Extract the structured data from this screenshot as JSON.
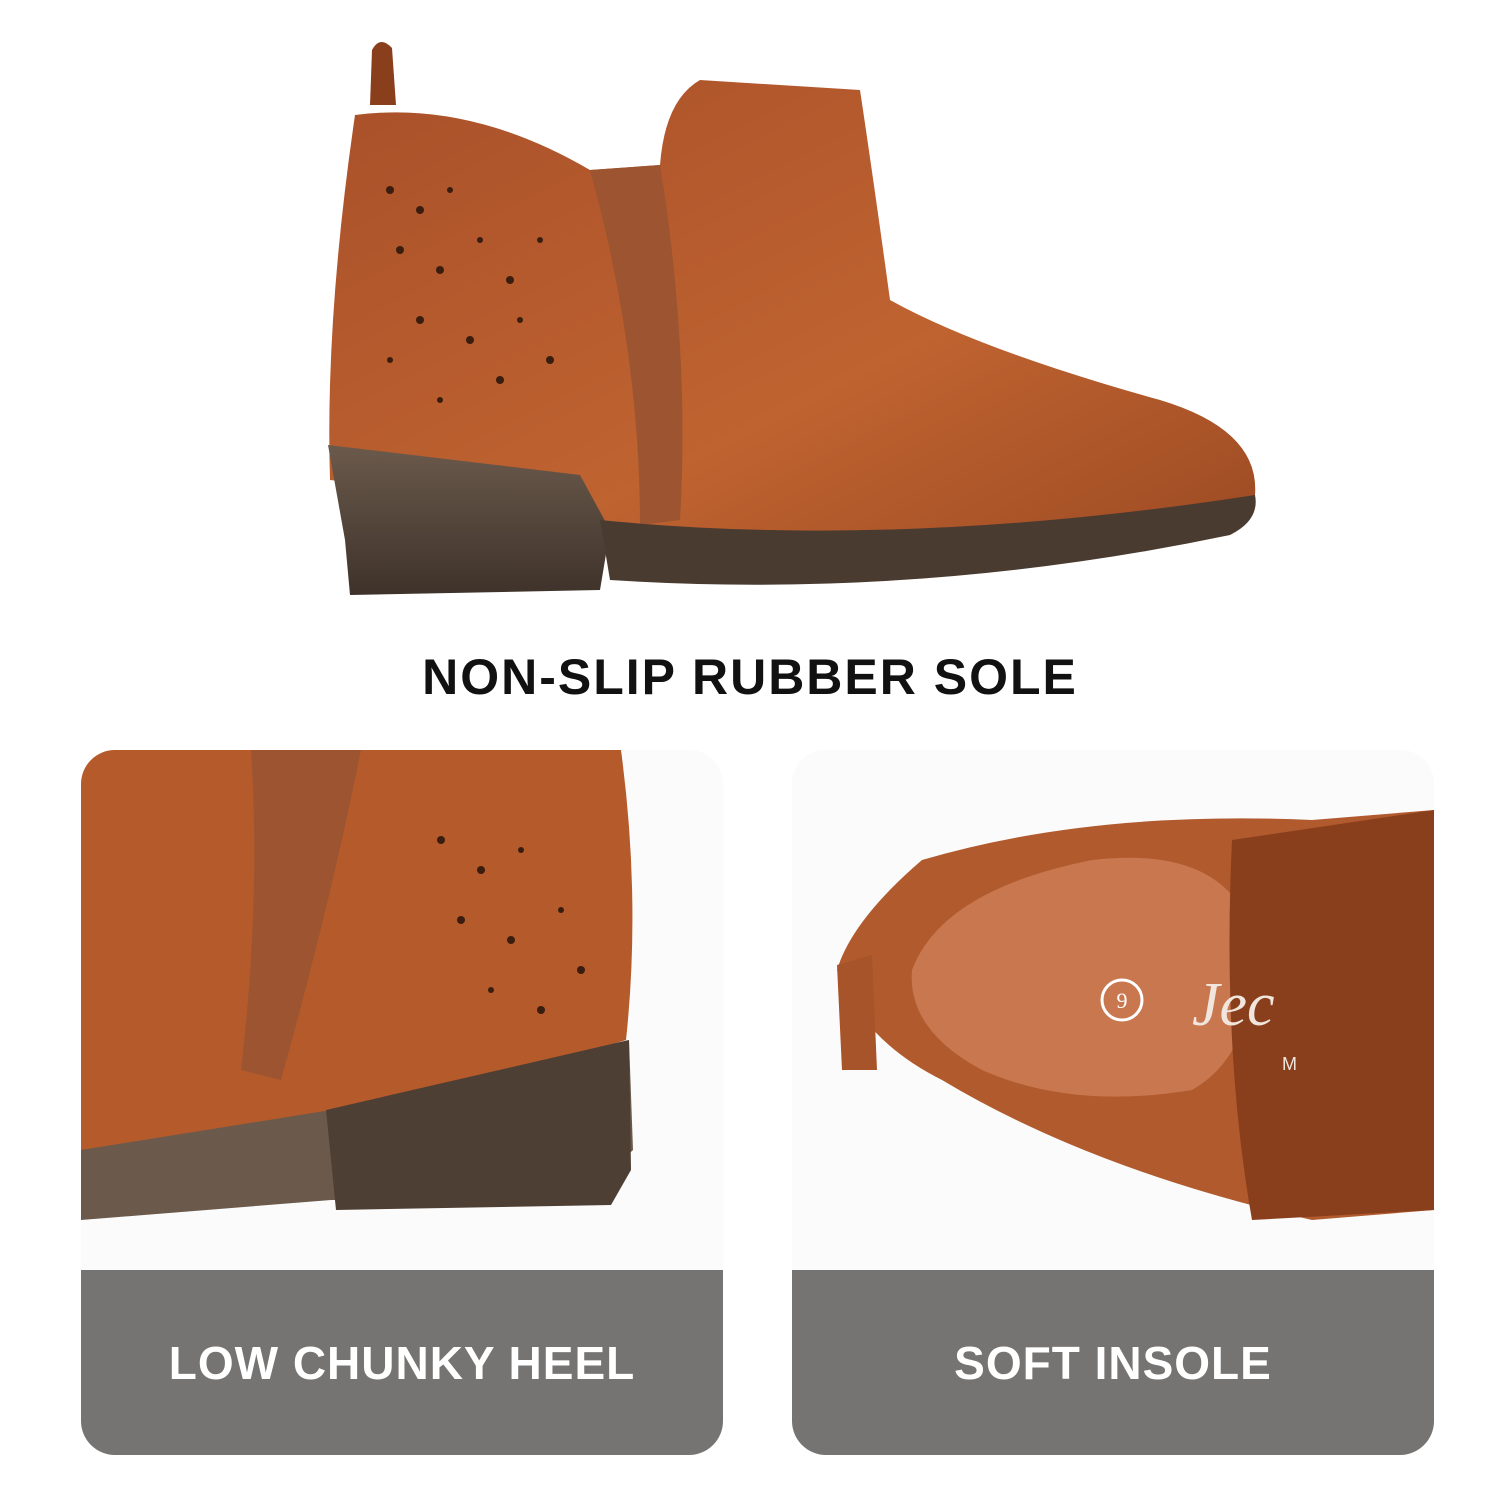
{
  "headline": "NON-SLIP RUBBER SOLE",
  "panels": [
    {
      "caption": "LOW CHUNKY HEEL"
    },
    {
      "caption": "SOFT INSOLE"
    }
  ],
  "insole_print": {
    "size": "9",
    "brand_partial": "Jec",
    "sub_partial": "M"
  },
  "colors": {
    "leather": "#b55a2b",
    "leather_dark": "#8a3f1c",
    "elastic": "#a8623a",
    "heel_wood": "#5a4a3e",
    "caption_bg": "#767472"
  }
}
